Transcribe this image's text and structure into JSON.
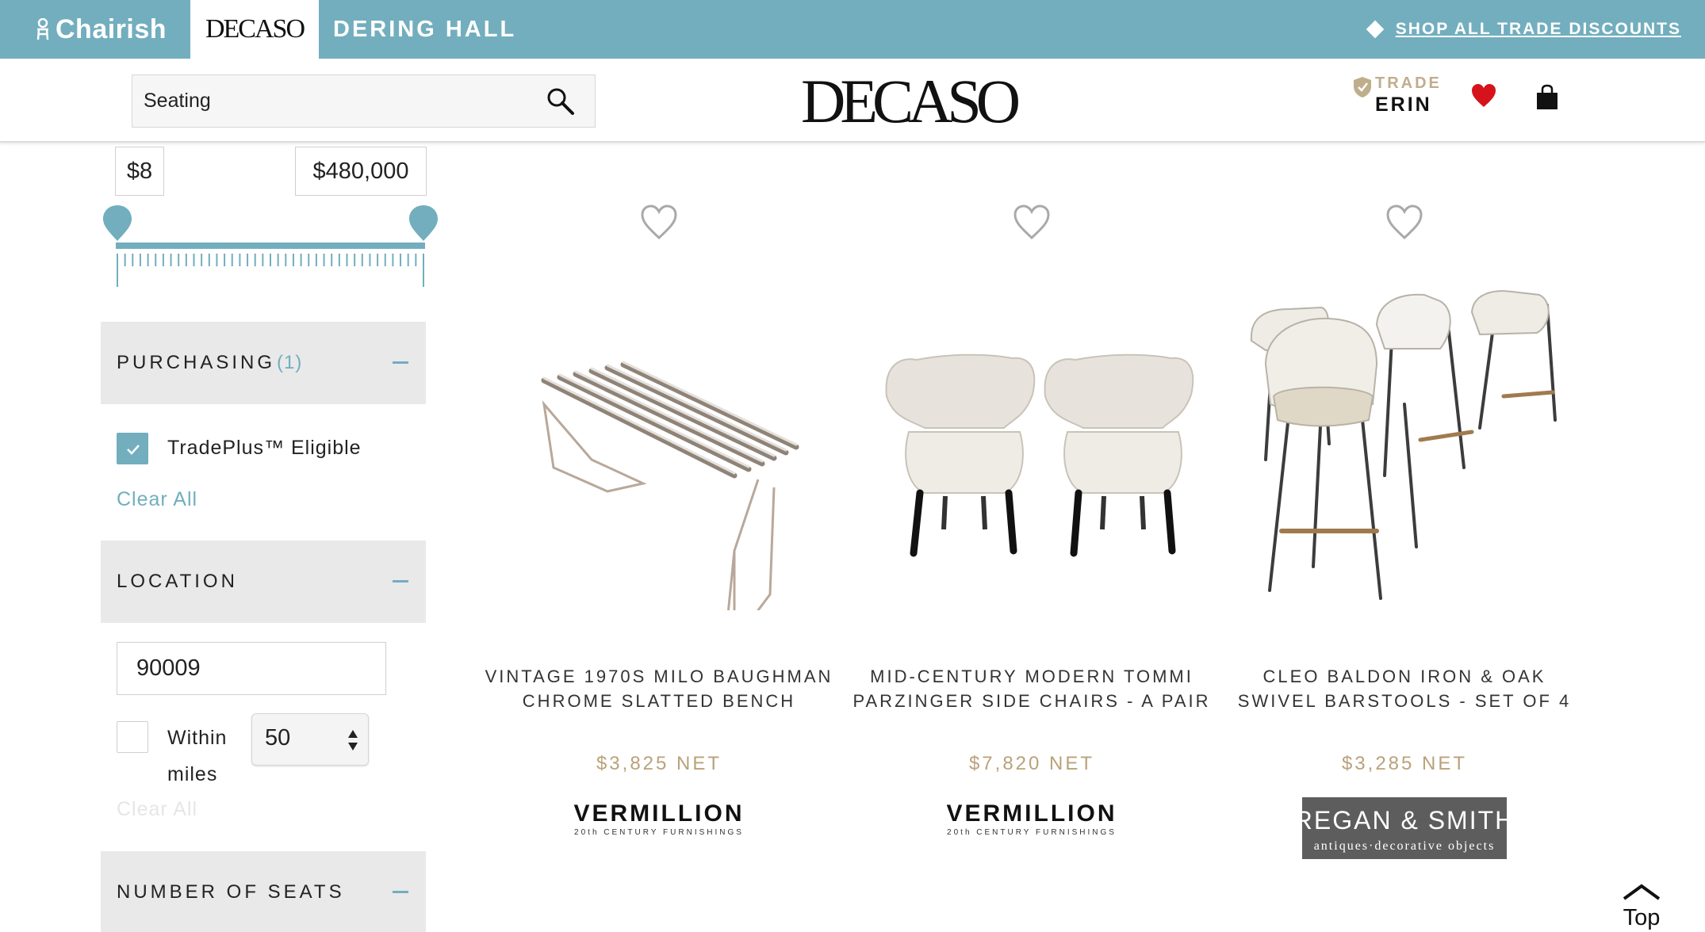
{
  "brand_bar": {
    "chairish": "Chairish",
    "decaso": "DECASO",
    "dering_hall": "DERING HALL",
    "trade_link": "SHOP ALL TRADE DISCOUNTS"
  },
  "header": {
    "search_value": "Seating",
    "logo": "DECASO",
    "trade_label": "TRADE",
    "user_name": "ERIN"
  },
  "sidebar": {
    "price_min": "$8",
    "price_max": "$480,000",
    "price_range_fraction": [
      0.0,
      1.0
    ],
    "purchasing": {
      "label": "PURCHASING",
      "count": "(1)",
      "option": "TradePlus™ Eligible",
      "option_checked": true,
      "clear": "Clear All"
    },
    "location": {
      "label": "LOCATION",
      "zip": "90009",
      "within_label": "Within",
      "within_checked": false,
      "miles_value": "50",
      "miles_label": "miles",
      "clear": "Clear All"
    },
    "seats": {
      "label": "NUMBER OF SEATS"
    }
  },
  "products": [
    {
      "title_line1": "VINTAGE 1970S MILO BAUGHMAN",
      "title_line2": "CHROME SLATTED BENCH",
      "price": "$3,825 NET",
      "seller": "VERMILLION",
      "seller_sub": "20th CENTURY FURNISHINGS"
    },
    {
      "title_line1": "MID-CENTURY MODERN TOMMI",
      "title_line2": "PARZINGER SIDE CHAIRS - A PAIR",
      "price": "$7,820 NET",
      "seller": "VERMILLION",
      "seller_sub": "20th CENTURY FURNISHINGS"
    },
    {
      "title_line1": "CLEO BALDON IRON & OAK",
      "title_line2": "SWIVEL BARSTOOLS - SET OF 4",
      "price": "$3,285 NET",
      "seller": "REGAN & SMITH",
      "seller_sub": "antiques·decorative objects"
    }
  ],
  "top_button": "Top",
  "icons": {
    "search": "search-icon",
    "heart": "heart-icon",
    "bag": "shopping-bag-icon",
    "favorite": "heart-outline-icon",
    "top": "chevron-up-icon"
  },
  "colors": {
    "accent": "#72aebe",
    "price": "#b9a27a",
    "heart": "#d6131b",
    "facet_bg": "#e9e9e9"
  }
}
